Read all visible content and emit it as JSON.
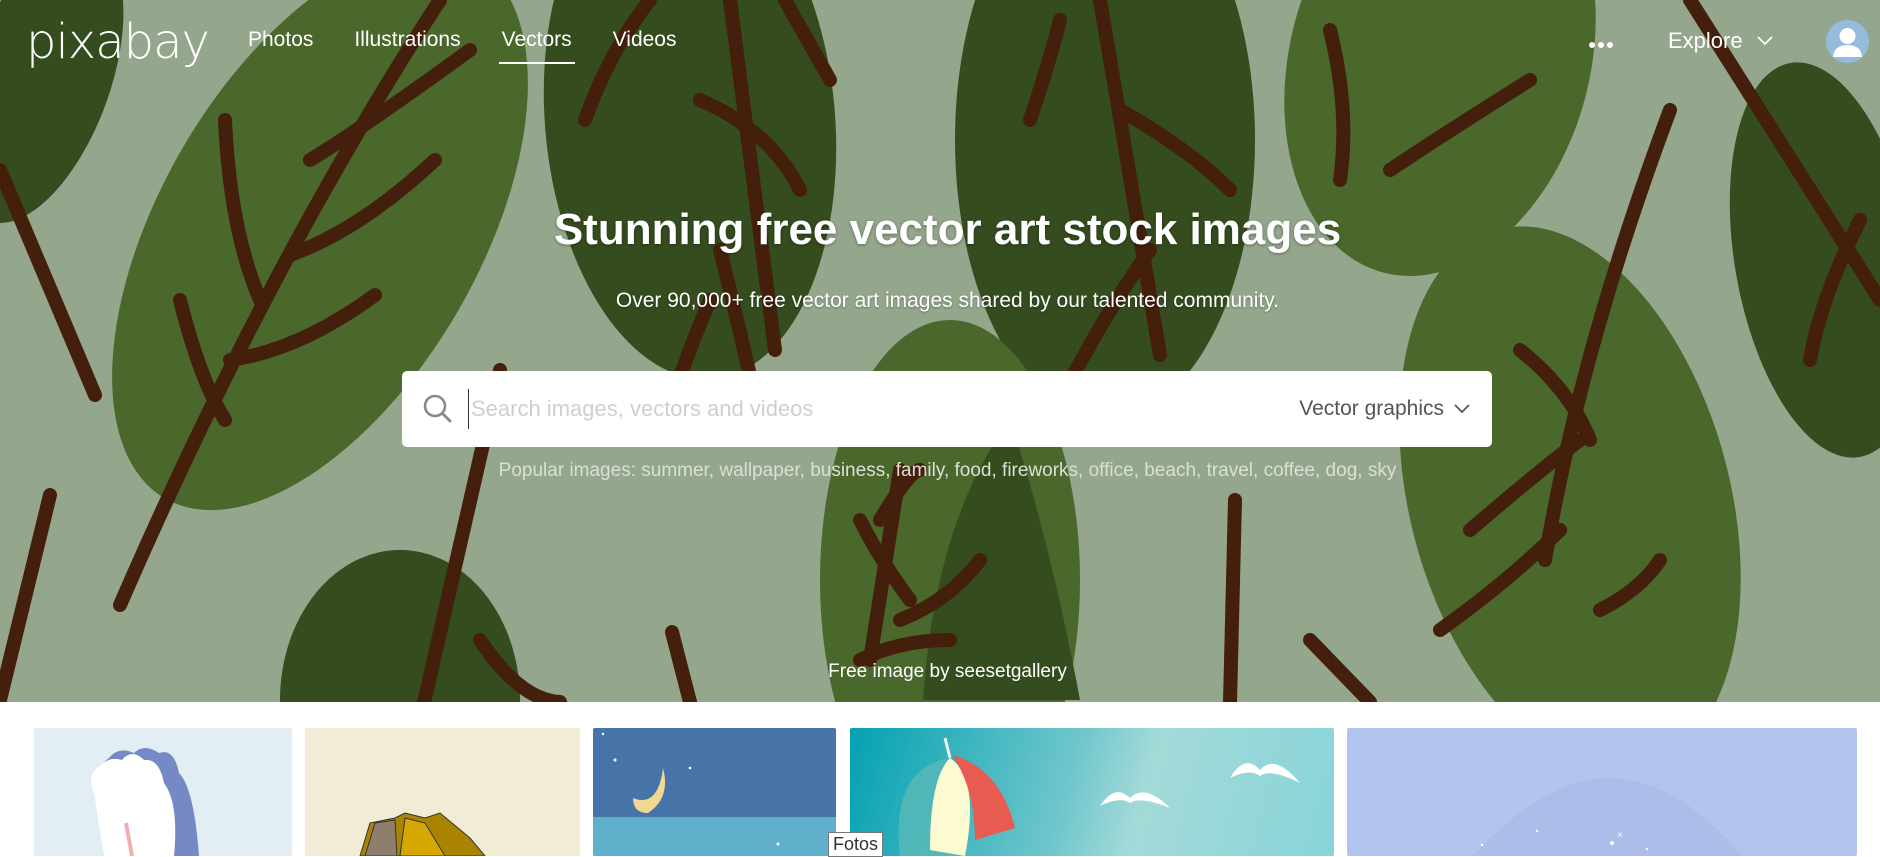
{
  "brand": {
    "logo_text": "pixabay"
  },
  "nav": {
    "items": [
      {
        "label": "Photos",
        "active": false
      },
      {
        "label": "Illustrations",
        "active": false
      },
      {
        "label": "Vectors",
        "active": true
      },
      {
        "label": "Videos",
        "active": false
      }
    ],
    "more_icon": "ellipsis-icon",
    "explore_label": "Explore",
    "avatar_icon": "user-avatar-icon"
  },
  "hero": {
    "title": "Stunning free vector art stock images",
    "subtitle": "Over 90,000+ free vector art images shared by our talented community.",
    "search": {
      "placeholder": "Search images, vectors and videos",
      "value": "",
      "type_selected": "Vector graphics"
    },
    "popular_prefix": "Popular images:",
    "popular_terms": [
      "summer",
      "wallpaper",
      "business",
      "family",
      "food",
      "fireworks",
      "office",
      "beach",
      "travel",
      "coffee",
      "dog",
      "sky"
    ],
    "popular_text": "Popular images: summer, wallpaper, business, family, food, fireworks, office, beach, travel, coffee, dog, sky",
    "credit": "Free image by seesetgallery",
    "colors": {
      "background": "#94a68c",
      "leaf_dark": "#354c1f",
      "leaf_mid": "#4a672c",
      "stem": "#431f0c"
    }
  },
  "gallery": {
    "tiles": [
      {
        "subject": "cloud illustration",
        "bg": "#e3eef4"
      },
      {
        "subject": "golden rocks illustration",
        "bg": "#f2ebd6"
      },
      {
        "subject": "moon over sea",
        "bg": "#4673a8"
      },
      {
        "subject": "beach umbrella and seagulls",
        "bg": "#4fb8c2"
      },
      {
        "subject": "starry dome",
        "bg": "#b3c4ef"
      }
    ],
    "tooltip": "Fotos"
  }
}
